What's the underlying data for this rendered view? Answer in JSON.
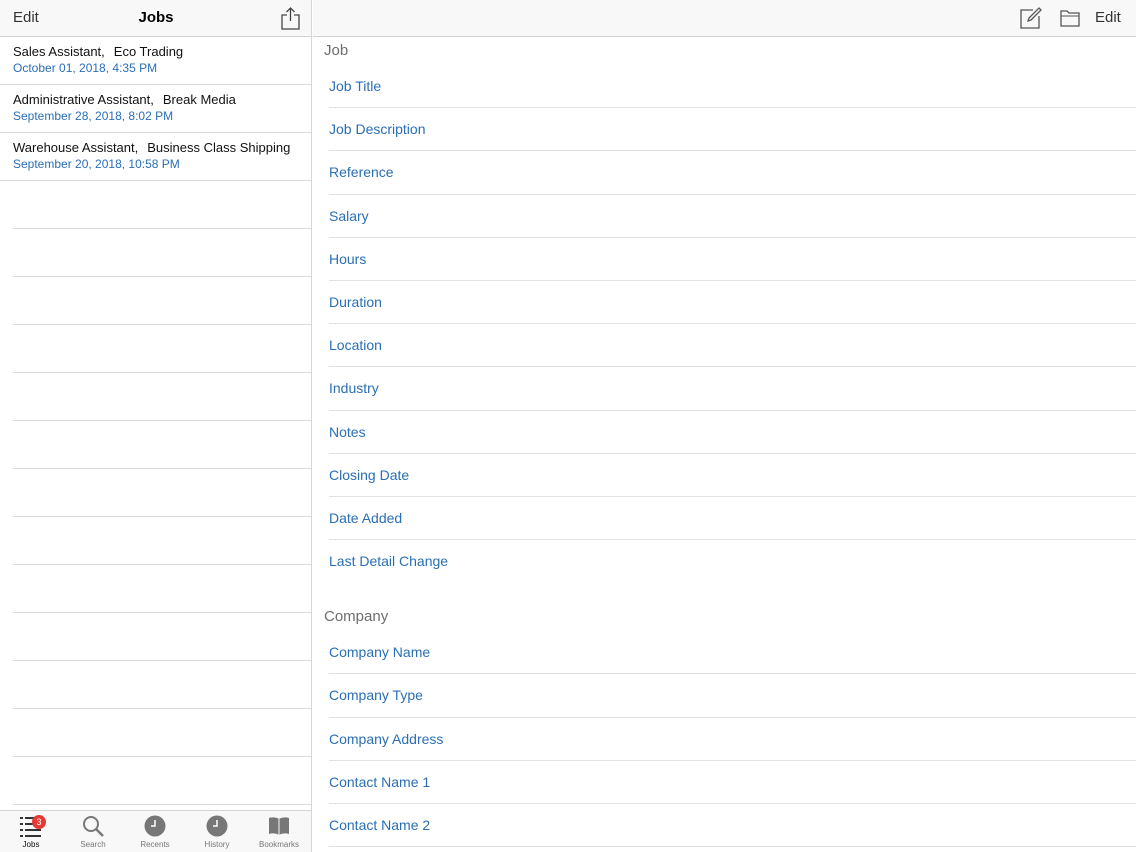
{
  "master": {
    "nav": {
      "edit_label": "Edit",
      "title": "Jobs",
      "share_icon": "share-icon"
    },
    "jobs": [
      {
        "title": "Sales Assistant,",
        "company": "Eco Trading",
        "date": "October 01, 2018, 4:35 PM"
      },
      {
        "title": "Administrative Assistant,",
        "company": "Break Media",
        "date": "September 28, 2018, 8:02 PM"
      },
      {
        "title": "Warehouse Assistant,",
        "company": "Business Class Shipping",
        "date": "September 20, 2018, 10:58 PM"
      }
    ],
    "tabs": [
      {
        "label": "Jobs",
        "icon": "list-icon",
        "badge": "3",
        "active": true
      },
      {
        "label": "Search",
        "icon": "search-icon"
      },
      {
        "label": "Recents",
        "icon": "clock-icon"
      },
      {
        "label": "History",
        "icon": "clock-icon"
      },
      {
        "label": "Bookmarks",
        "icon": "book-icon"
      }
    ]
  },
  "detail": {
    "nav": {
      "edit_label": "Edit",
      "compose_icon": "compose-icon",
      "folder_icon": "folder-icon"
    },
    "sections": [
      {
        "header": "Job",
        "fields": [
          "Job Title",
          "Job Description",
          "Reference",
          "Salary",
          "Hours",
          "Duration",
          "Location",
          "Industry",
          "Notes",
          "Closing Date",
          "Date Added",
          "Last Detail Change"
        ]
      },
      {
        "header": "Company",
        "fields": [
          "Company Name",
          "Company Type",
          "Company Address",
          "Contact Name 1",
          "Contact Name 2"
        ]
      }
    ]
  },
  "colors": {
    "link": "#2a6fb5",
    "badge": "#e53935",
    "bar": "#f8f8f8"
  }
}
